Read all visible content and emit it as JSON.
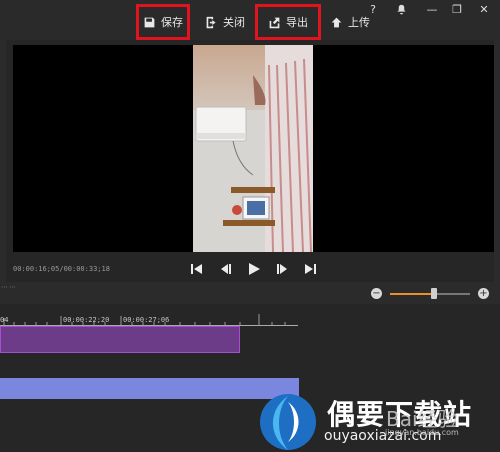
{
  "toolbar": {
    "save_label": "保存",
    "close_label": "关闭",
    "export_label": "导出",
    "upload_label": "上传",
    "help_label": "?",
    "minimize_label": "—",
    "restore_label": "❐",
    "close_window_label": "✕"
  },
  "player": {
    "timecode": "00:00:16;05/00:00:33;18",
    "zoom_level": 0.55
  },
  "timeline": {
    "ticks": [
      "04",
      "00:00:22;20",
      "00:00:27;06"
    ]
  },
  "watermark": {
    "title": "偶要下载站",
    "url": "ouyaoxiazai.com",
    "baidu": "Bai",
    "baidu_suffix": "经验",
    "baidu_url": "jingyan.baidu.com"
  },
  "colors": {
    "highlight": "#e0141e",
    "track_purple": "#6c3c88",
    "track_blue": "#7b86df",
    "zoom_accent": "#e8902a"
  }
}
